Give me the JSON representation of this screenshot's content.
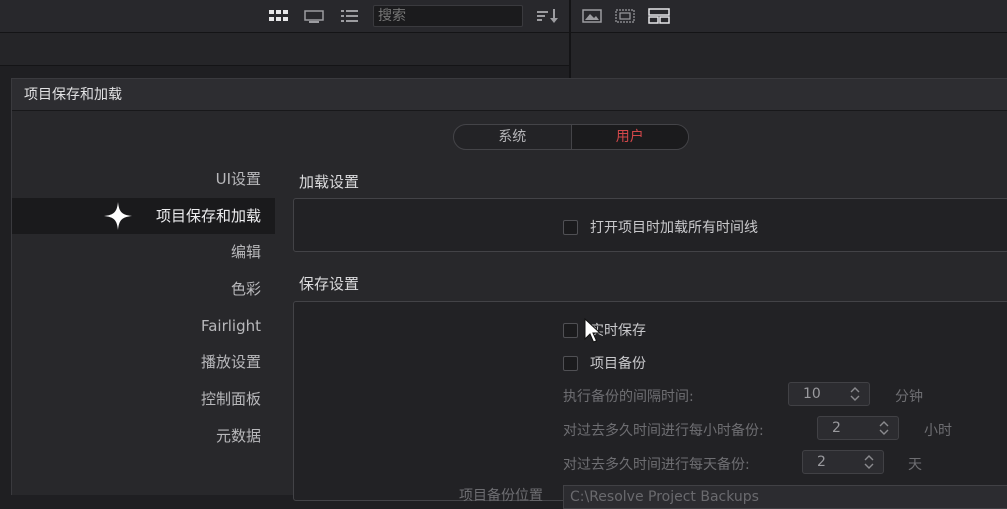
{
  "toolbar": {
    "search_placeholder": "搜索",
    "icons": [
      "grid-view-icon",
      "filmstrip-view-icon",
      "list-view-icon",
      "sort-icon",
      "image-icon",
      "clip-frame-icon",
      "layout-icon"
    ]
  },
  "dialog": {
    "title": "项目保存和加载",
    "segment": {
      "system": "系统",
      "user": "用户",
      "selected": "用户"
    },
    "sidebar": {
      "items": [
        {
          "label": "UI设置"
        },
        {
          "label": "项目保存和加载",
          "active": true
        },
        {
          "label": "编辑"
        },
        {
          "label": "色彩"
        },
        {
          "label": "Fairlight"
        },
        {
          "label": "播放设置"
        },
        {
          "label": "控制面板"
        },
        {
          "label": "元数据"
        }
      ]
    },
    "load": {
      "title": "加载设置",
      "load_all_timelines": "打开项目时加载所有时间线"
    },
    "save": {
      "title": "保存设置",
      "live_save": "实时保存",
      "project_backup": "项目备份",
      "interval_label": "执行备份的间隔时间:",
      "interval_value": "10",
      "interval_unit": "分钟",
      "hourly_label": "对过去多久时间进行每小时备份:",
      "hourly_value": "2",
      "hourly_unit": "小时",
      "daily_label": "对过去多久时间进行每天备份:",
      "daily_value": "2",
      "daily_unit": "天",
      "location_label": "项目备份位置",
      "location_value": "C:\\Resolve Project Backups"
    }
  },
  "colors": {
    "accent": "#d2474a",
    "background": "#28282b"
  }
}
